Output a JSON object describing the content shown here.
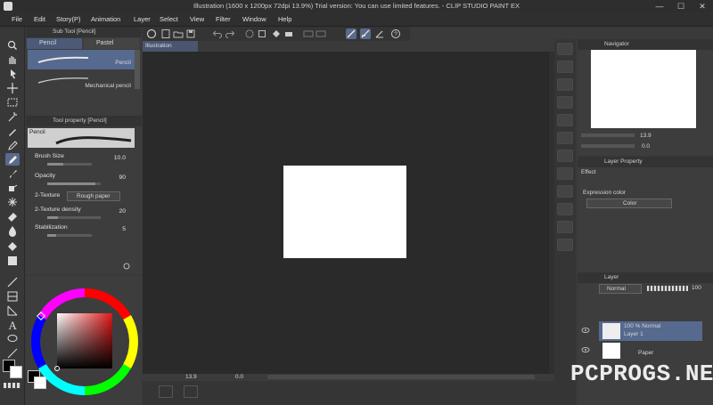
{
  "title": "Illustration (1600 x 1200px 72dpi 13.9%)  Trial version: You can use limited features. - CLIP STUDIO PAINT EX",
  "menu": [
    "File",
    "Edit",
    "Story(P)",
    "Animation",
    "Layer",
    "Select",
    "View",
    "Filter",
    "Window",
    "Help"
  ],
  "window_controls": {
    "minimize": "—",
    "maximize": "☐",
    "close": "✕"
  },
  "subtool_panel": {
    "title": "Sub Tool [Pencil]",
    "tabs": [
      "Pencil",
      "Pastel"
    ],
    "brushes": [
      "Pencil",
      "Mechanical pencil"
    ]
  },
  "tool_property": {
    "title": "Tool property [Pencil]",
    "preview_label": "Pencil",
    "brush_size": {
      "label": "Brush Size",
      "value": "10.0",
      "level": 0.35
    },
    "opacity": {
      "label": "Opacity",
      "value": "90",
      "level": 0.9
    },
    "texture": {
      "label": "2-Texture",
      "value": "Rough paper"
    },
    "texture_density": {
      "label": "2-Texture density",
      "value": "20",
      "level": 0.2
    },
    "stabilization": {
      "label": "Stabilization",
      "value": "5",
      "level": 0.2
    }
  },
  "document_tab": "Illustration",
  "status": {
    "zoom": "13.9",
    "angle": "0.0"
  },
  "navigator": {
    "title": "Navigator",
    "zoom": "13.9",
    "rotation": "0.0"
  },
  "layer_property": {
    "title": "Layer Property",
    "effect_label": "Effect",
    "expression_color_label": "Expression color",
    "expression_color_value": "Color"
  },
  "layer_panel": {
    "title": "Layer",
    "blend_mode": "Normal",
    "opacity": "100",
    "layers": [
      {
        "line1": "100 % Normal",
        "line2": "Layer 1"
      },
      {
        "line1": "",
        "line2": "Paper"
      }
    ]
  },
  "colors": {
    "accent": "#5a6a8a",
    "bg": "#3a3a3a",
    "canvas_bg": "#2a2a2a",
    "paper": "#ffffff",
    "main_color": "#000000",
    "sub_color": "#ffffff"
  },
  "watermark": "PCPROGS.NET"
}
